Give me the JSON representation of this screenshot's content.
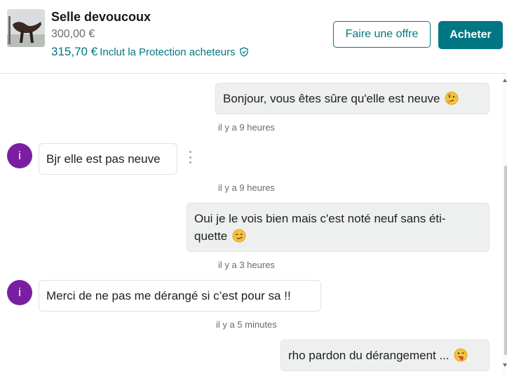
{
  "listing": {
    "title": "Selle devoucoux",
    "price": "300,00 €",
    "protected_price": "315,70 €",
    "protection_label": "Inclut la Protection acheteurs",
    "offer_button": "Faire une offre",
    "buy_button": "Acheter"
  },
  "colors": {
    "accent": "#007782",
    "avatar": "#7a1fa2",
    "outgoing_bubble": "#eef0f0"
  },
  "messages": [
    {
      "from": "me",
      "text": "Bonjour, vous êtes sûre qu'elle est neuve",
      "emoji": "thinking-face",
      "time": "il y a 9 heures"
    },
    {
      "from": "seller",
      "avatar_letter": "i",
      "text": "Bjr elle est pas neuve",
      "time": "il y a 9 heures"
    },
    {
      "from": "me",
      "text_line1": "Oui je le vois bien mais c'est noté neuf sans éti-",
      "text_line2": "quette",
      "emoji": "smirking-face",
      "time": "il y a 3 heures"
    },
    {
      "from": "seller",
      "avatar_letter": "i",
      "text": "Merci de ne pas me dérangé si c’est pour sa !!",
      "time": "il y a 5 minutes"
    },
    {
      "from": "me",
      "text": "rho pardon du dérangement ...",
      "emoji": "face-with-tongue-winking"
    }
  ]
}
